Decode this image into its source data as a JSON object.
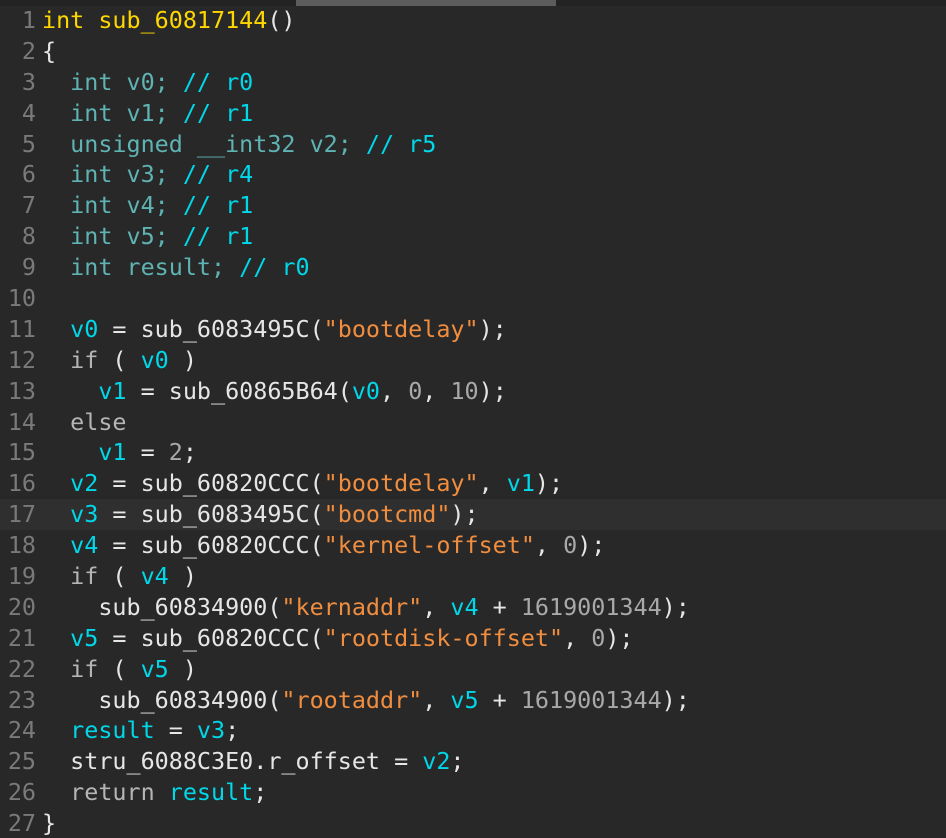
{
  "editor": {
    "lines": [
      {
        "num": "1",
        "tokens": [
          [
            "kw",
            "int sub_60817144"
          ],
          [
            "punc",
            "()"
          ]
        ]
      },
      {
        "num": "2",
        "tokens": [
          [
            "punc",
            "{"
          ]
        ]
      },
      {
        "num": "3",
        "tokens": [
          [
            "punc",
            "  "
          ],
          [
            "type",
            "int v0; "
          ],
          [
            "cmt",
            "// r0"
          ]
        ]
      },
      {
        "num": "4",
        "tokens": [
          [
            "punc",
            "  "
          ],
          [
            "type",
            "int v1; "
          ],
          [
            "cmt",
            "// r1"
          ]
        ]
      },
      {
        "num": "5",
        "tokens": [
          [
            "punc",
            "  "
          ],
          [
            "type",
            "unsigned __int32 v2; "
          ],
          [
            "cmt",
            "// r5"
          ]
        ]
      },
      {
        "num": "6",
        "tokens": [
          [
            "punc",
            "  "
          ],
          [
            "type",
            "int v3; "
          ],
          [
            "cmt",
            "// r4"
          ]
        ]
      },
      {
        "num": "7",
        "tokens": [
          [
            "punc",
            "  "
          ],
          [
            "type",
            "int v4; "
          ],
          [
            "cmt",
            "// r1"
          ]
        ]
      },
      {
        "num": "8",
        "tokens": [
          [
            "punc",
            "  "
          ],
          [
            "type",
            "int v5; "
          ],
          [
            "cmt",
            "// r1"
          ]
        ]
      },
      {
        "num": "9",
        "tokens": [
          [
            "punc",
            "  "
          ],
          [
            "type",
            "int result; "
          ],
          [
            "cmt",
            "// r0"
          ]
        ]
      },
      {
        "num": "10",
        "tokens": []
      },
      {
        "num": "11",
        "tokens": [
          [
            "punc",
            "  "
          ],
          [
            "var",
            "v0"
          ],
          [
            "id",
            " = sub_6083495C("
          ],
          [
            "str",
            "\"bootdelay\""
          ],
          [
            "id",
            ");"
          ]
        ]
      },
      {
        "num": "12",
        "tokens": [
          [
            "punc",
            "  "
          ],
          [
            "kwplain",
            "if"
          ],
          [
            "id",
            " ( "
          ],
          [
            "var",
            "v0"
          ],
          [
            "id",
            " )"
          ]
        ]
      },
      {
        "num": "13",
        "tokens": [
          [
            "punc",
            "    "
          ],
          [
            "var",
            "v1"
          ],
          [
            "id",
            " = sub_60865B64("
          ],
          [
            "var",
            "v0"
          ],
          [
            "id",
            ", "
          ],
          [
            "num",
            "0"
          ],
          [
            "id",
            ", "
          ],
          [
            "num",
            "10"
          ],
          [
            "id",
            ");"
          ]
        ]
      },
      {
        "num": "14",
        "tokens": [
          [
            "punc",
            "  "
          ],
          [
            "kwplain",
            "else"
          ]
        ]
      },
      {
        "num": "15",
        "tokens": [
          [
            "punc",
            "    "
          ],
          [
            "var",
            "v1"
          ],
          [
            "id",
            " = "
          ],
          [
            "num",
            "2"
          ],
          [
            "id",
            ";"
          ]
        ]
      },
      {
        "num": "16",
        "tokens": [
          [
            "punc",
            "  "
          ],
          [
            "var",
            "v2"
          ],
          [
            "id",
            " = sub_60820CCC("
          ],
          [
            "str",
            "\"bootdelay\""
          ],
          [
            "id",
            ", "
          ],
          [
            "var",
            "v1"
          ],
          [
            "id",
            ");"
          ]
        ]
      },
      {
        "num": "17",
        "tokens": [
          [
            "punc",
            "  "
          ],
          [
            "var",
            "v3"
          ],
          [
            "id",
            " = sub_6083495C("
          ],
          [
            "str",
            "\"bootcmd\""
          ],
          [
            "id",
            ");"
          ]
        ],
        "current": true
      },
      {
        "num": "18",
        "tokens": [
          [
            "punc",
            "  "
          ],
          [
            "var",
            "v4"
          ],
          [
            "id",
            " = sub_60820CCC("
          ],
          [
            "str",
            "\"kernel-offset\""
          ],
          [
            "id",
            ", "
          ],
          [
            "num",
            "0"
          ],
          [
            "id",
            ");"
          ]
        ]
      },
      {
        "num": "19",
        "tokens": [
          [
            "punc",
            "  "
          ],
          [
            "kwplain",
            "if"
          ],
          [
            "id",
            " ( "
          ],
          [
            "var",
            "v4"
          ],
          [
            "id",
            " )"
          ]
        ]
      },
      {
        "num": "20",
        "tokens": [
          [
            "punc",
            "    "
          ],
          [
            "id",
            "sub_60834900("
          ],
          [
            "str",
            "\"kernaddr\""
          ],
          [
            "id",
            ", "
          ],
          [
            "var",
            "v4"
          ],
          [
            "id",
            " + "
          ],
          [
            "num",
            "1619001344"
          ],
          [
            "id",
            ");"
          ]
        ]
      },
      {
        "num": "21",
        "tokens": [
          [
            "punc",
            "  "
          ],
          [
            "var",
            "v5"
          ],
          [
            "id",
            " = sub_60820CCC("
          ],
          [
            "str",
            "\"rootdisk-offset\""
          ],
          [
            "id",
            ", "
          ],
          [
            "num",
            "0"
          ],
          [
            "id",
            ");"
          ]
        ]
      },
      {
        "num": "22",
        "tokens": [
          [
            "punc",
            "  "
          ],
          [
            "kwplain",
            "if"
          ],
          [
            "id",
            " ( "
          ],
          [
            "var",
            "v5"
          ],
          [
            "id",
            " )"
          ]
        ]
      },
      {
        "num": "23",
        "tokens": [
          [
            "punc",
            "    "
          ],
          [
            "id",
            "sub_60834900("
          ],
          [
            "str",
            "\"rootaddr\""
          ],
          [
            "id",
            ", "
          ],
          [
            "var",
            "v5"
          ],
          [
            "id",
            " + "
          ],
          [
            "num",
            "1619001344"
          ],
          [
            "id",
            ");"
          ]
        ]
      },
      {
        "num": "24",
        "tokens": [
          [
            "punc",
            "  "
          ],
          [
            "var",
            "result"
          ],
          [
            "id",
            " = "
          ],
          [
            "var",
            "v3"
          ],
          [
            "id",
            ";"
          ]
        ]
      },
      {
        "num": "25",
        "tokens": [
          [
            "punc",
            "  "
          ],
          [
            "id",
            "stru_6088C3E0.r_offset = "
          ],
          [
            "var",
            "v2"
          ],
          [
            "id",
            ";"
          ]
        ]
      },
      {
        "num": "26",
        "tokens": [
          [
            "punc",
            "  "
          ],
          [
            "kwplain",
            "return"
          ],
          [
            "id",
            " "
          ],
          [
            "var",
            "result"
          ],
          [
            "id",
            ";"
          ]
        ]
      },
      {
        "num": "27",
        "tokens": [
          [
            "punc",
            "}"
          ]
        ]
      }
    ]
  },
  "colors": {
    "background": "#282828",
    "keyword": "#ffd700",
    "variable": "#00d7e8",
    "string": "#f08d3f",
    "type": "#5fb3b3"
  }
}
